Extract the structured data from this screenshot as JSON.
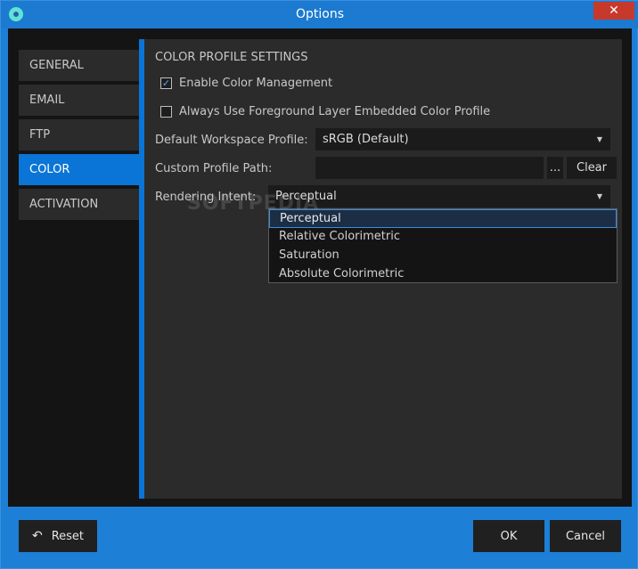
{
  "window": {
    "title": "Options",
    "close_glyph": "✕"
  },
  "sidebar": {
    "items": [
      {
        "label": "GENERAL",
        "active": false
      },
      {
        "label": "EMAIL",
        "active": false
      },
      {
        "label": "FTP",
        "active": false
      },
      {
        "label": "COLOR",
        "active": true
      },
      {
        "label": "ACTIVATION",
        "active": false
      }
    ]
  },
  "color": {
    "section_title": "COLOR PROFILE SETTINGS",
    "enable_color_management": {
      "label": "Enable Color Management",
      "checked": true
    },
    "always_use_foreground": {
      "label": "Always Use Foreground Layer Embedded Color Profile",
      "checked": false
    },
    "default_workspace_profile": {
      "label": "Default Workspace Profile:",
      "value": "sRGB (Default)"
    },
    "custom_profile_path": {
      "label": "Custom Profile Path:",
      "value": "",
      "browse_label": "...",
      "clear_label": "Clear"
    },
    "rendering_intent": {
      "label": "Rendering Intent:",
      "value": "Perceptual",
      "options": [
        "Perceptual",
        "Relative Colorimetric",
        "Saturation",
        "Absolute Colorimetric"
      ]
    }
  },
  "watermark": "SOFTPEDIA",
  "footer": {
    "reset_label": "Reset",
    "ok_label": "OK",
    "cancel_label": "Cancel"
  },
  "colors": {
    "accent": "#0a75d6",
    "panel": "#2b2b2b",
    "field": "#1b1b1b"
  }
}
